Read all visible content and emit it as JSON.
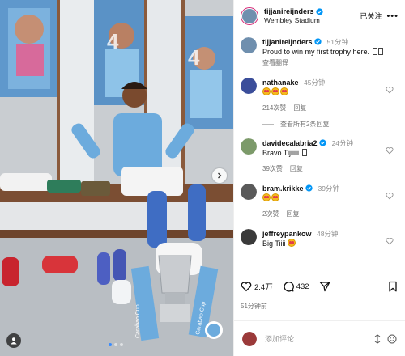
{
  "post": {
    "username": "tijjanireijnders",
    "location": "Wembley Stadium",
    "follow_state": "已关注",
    "more": "•••",
    "caption_user": "tijjanireijnders",
    "caption_time": "51分钟",
    "caption_text": "Proud to win my first trophy here.",
    "translate": "查看翻译",
    "likes": "2.4万",
    "comment_count": "432",
    "posted_ago": "51分钟前",
    "comment_placeholder": "添加评论...",
    "photo_banner_text": "Carabao Cup"
  },
  "comments": [
    {
      "user": "nathanake",
      "time": "45分钟",
      "emoji_count": 3,
      "text": "",
      "likes": "214次赞",
      "reply": "回复"
    },
    {
      "user": "davidecalabria2",
      "time": "24分钟",
      "emoji_count": 0,
      "text": "Bravo Tijiiiii",
      "likes": "39次赞",
      "reply": "回复"
    },
    {
      "user": "bram.krikke",
      "time": "39分钟",
      "emoji_count": 2,
      "text": "",
      "likes": "2次赞",
      "reply": "回复"
    },
    {
      "user": "jeffreypankow",
      "time": "48分钟",
      "emoji_count": 1,
      "text": "Big Tiiii",
      "likes": "",
      "reply": ""
    }
  ],
  "see_replies": "查看所有2条回复",
  "colors": {
    "accent": "#0095f6",
    "verified": "#0095f6",
    "muted": "#737373",
    "kit_blue": "#6cabdd"
  },
  "icons": [
    "heart-icon",
    "comment-icon",
    "share-icon",
    "bookmark-icon",
    "emoji-icon",
    "verified-icon",
    "user-tag-icon"
  ]
}
